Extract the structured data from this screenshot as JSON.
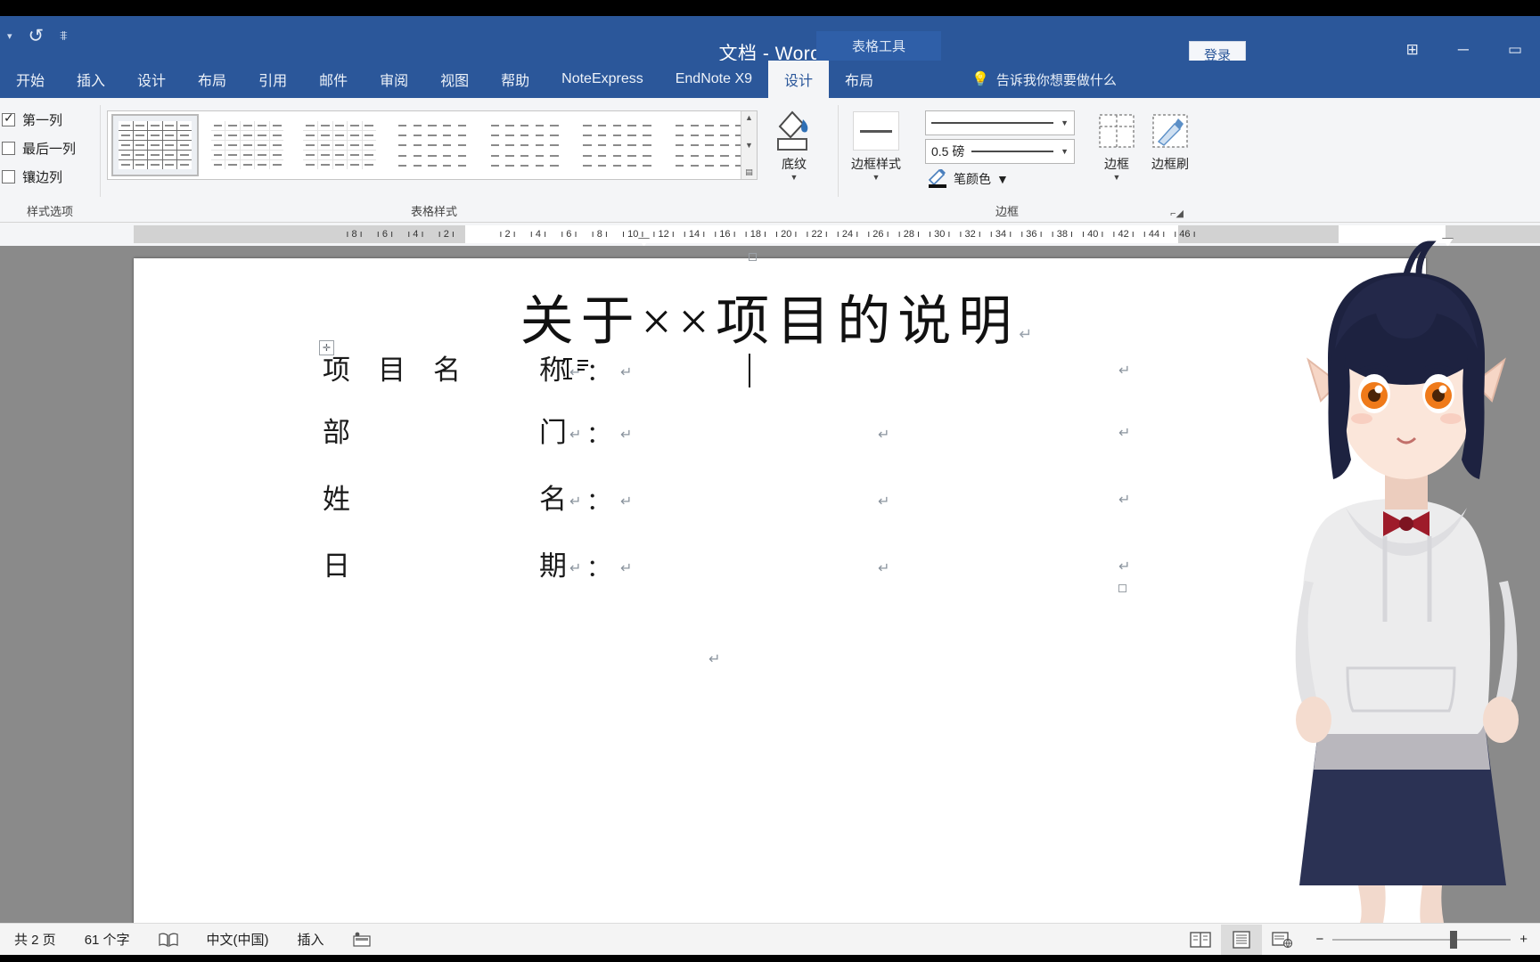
{
  "window": {
    "title": "文档  -  Word",
    "context_tab_group": "表格工具",
    "signin_label": "登录",
    "quick_access": [
      "undo-icon",
      "customize-icon"
    ],
    "controls": [
      "ribbon-display-icon",
      "minimize-icon",
      "restore-icon"
    ],
    "accent_color": "#2b579a"
  },
  "tabs": [
    {
      "label": "开始",
      "active": false
    },
    {
      "label": "插入",
      "active": false
    },
    {
      "label": "设计",
      "active": false
    },
    {
      "label": "布局",
      "active": false
    },
    {
      "label": "引用",
      "active": false
    },
    {
      "label": "邮件",
      "active": false
    },
    {
      "label": "审阅",
      "active": false
    },
    {
      "label": "视图",
      "active": false
    },
    {
      "label": "帮助",
      "active": false
    },
    {
      "label": "NoteExpress",
      "active": false
    },
    {
      "label": "EndNote X9",
      "active": false
    },
    {
      "label": "设计",
      "active": true
    },
    {
      "label": "布局",
      "active": false
    }
  ],
  "tell_me": "告诉我你想要做什么",
  "ribbon": {
    "style_options": {
      "group_label": "样式选项",
      "items": [
        {
          "label": "第一列",
          "checked": true
        },
        {
          "label": "最后一列",
          "checked": false
        },
        {
          "label": "镶边列",
          "checked": false
        }
      ]
    },
    "table_styles": {
      "group_label": "表格样式",
      "selected_index": 0,
      "count": 7
    },
    "shading": {
      "label": "底纹"
    },
    "borders": {
      "group_label": "边框",
      "border_styles_label": "边框样式",
      "line_weight": "0.5 磅",
      "pen_color_label": "笔颜色",
      "borders_label": "边框",
      "border_painter_label": "边框刷"
    }
  },
  "ruler": {
    "left_ticks": [
      "8",
      "6",
      "4",
      "2"
    ],
    "right_ticks": [
      "2",
      "4",
      "6",
      "8",
      "10",
      "12",
      "14",
      "16",
      "18",
      "20",
      "22",
      "24",
      "26",
      "28",
      "30",
      "32",
      "34",
      "36",
      "38",
      "40",
      "42",
      "44",
      "46"
    ]
  },
  "document": {
    "title": "关于××项目的说明",
    "paragraph_mark": "↵",
    "rows": [
      {
        "left": "项　目　名　称",
        "right_label": "称",
        "colon": "："
      },
      {
        "left": "部",
        "right_label": "门",
        "colon": "："
      },
      {
        "left": "姓",
        "right_label": "名",
        "colon": "："
      },
      {
        "left": "日",
        "right_label": "期",
        "colon": "："
      }
    ],
    "form_lines": [
      {
        "label_left": "项　目　名",
        "label_right": "称",
        "colon": "："
      },
      {
        "label_left": "部",
        "label_right": "门",
        "colon": "："
      },
      {
        "label_left": "姓",
        "label_right": "名",
        "colon": "："
      },
      {
        "label_left": "日",
        "label_right": "期",
        "colon": "："
      }
    ]
  },
  "status_bar": {
    "page_info": "共 2 页",
    "word_count": "61 个字",
    "proofing_icon": "proofing-icon",
    "language": "中文(中国)",
    "insert_mode": "插入",
    "macro_icon": "macro-record-icon",
    "views": [
      {
        "name": "read-mode-icon",
        "active": false
      },
      {
        "name": "print-layout-icon",
        "active": true
      },
      {
        "name": "web-layout-icon",
        "active": false
      }
    ],
    "zoom_out": "−",
    "zoom_in": "+"
  },
  "overlay": {
    "avatar_name": "vtuber-avatar",
    "hair_color": "#1d2240",
    "eye_color": "#ef7a1a",
    "hoodie_color": "#e9e9ec",
    "skirt_color": "#2b3254",
    "bow_color": "#9e1b2a"
  }
}
